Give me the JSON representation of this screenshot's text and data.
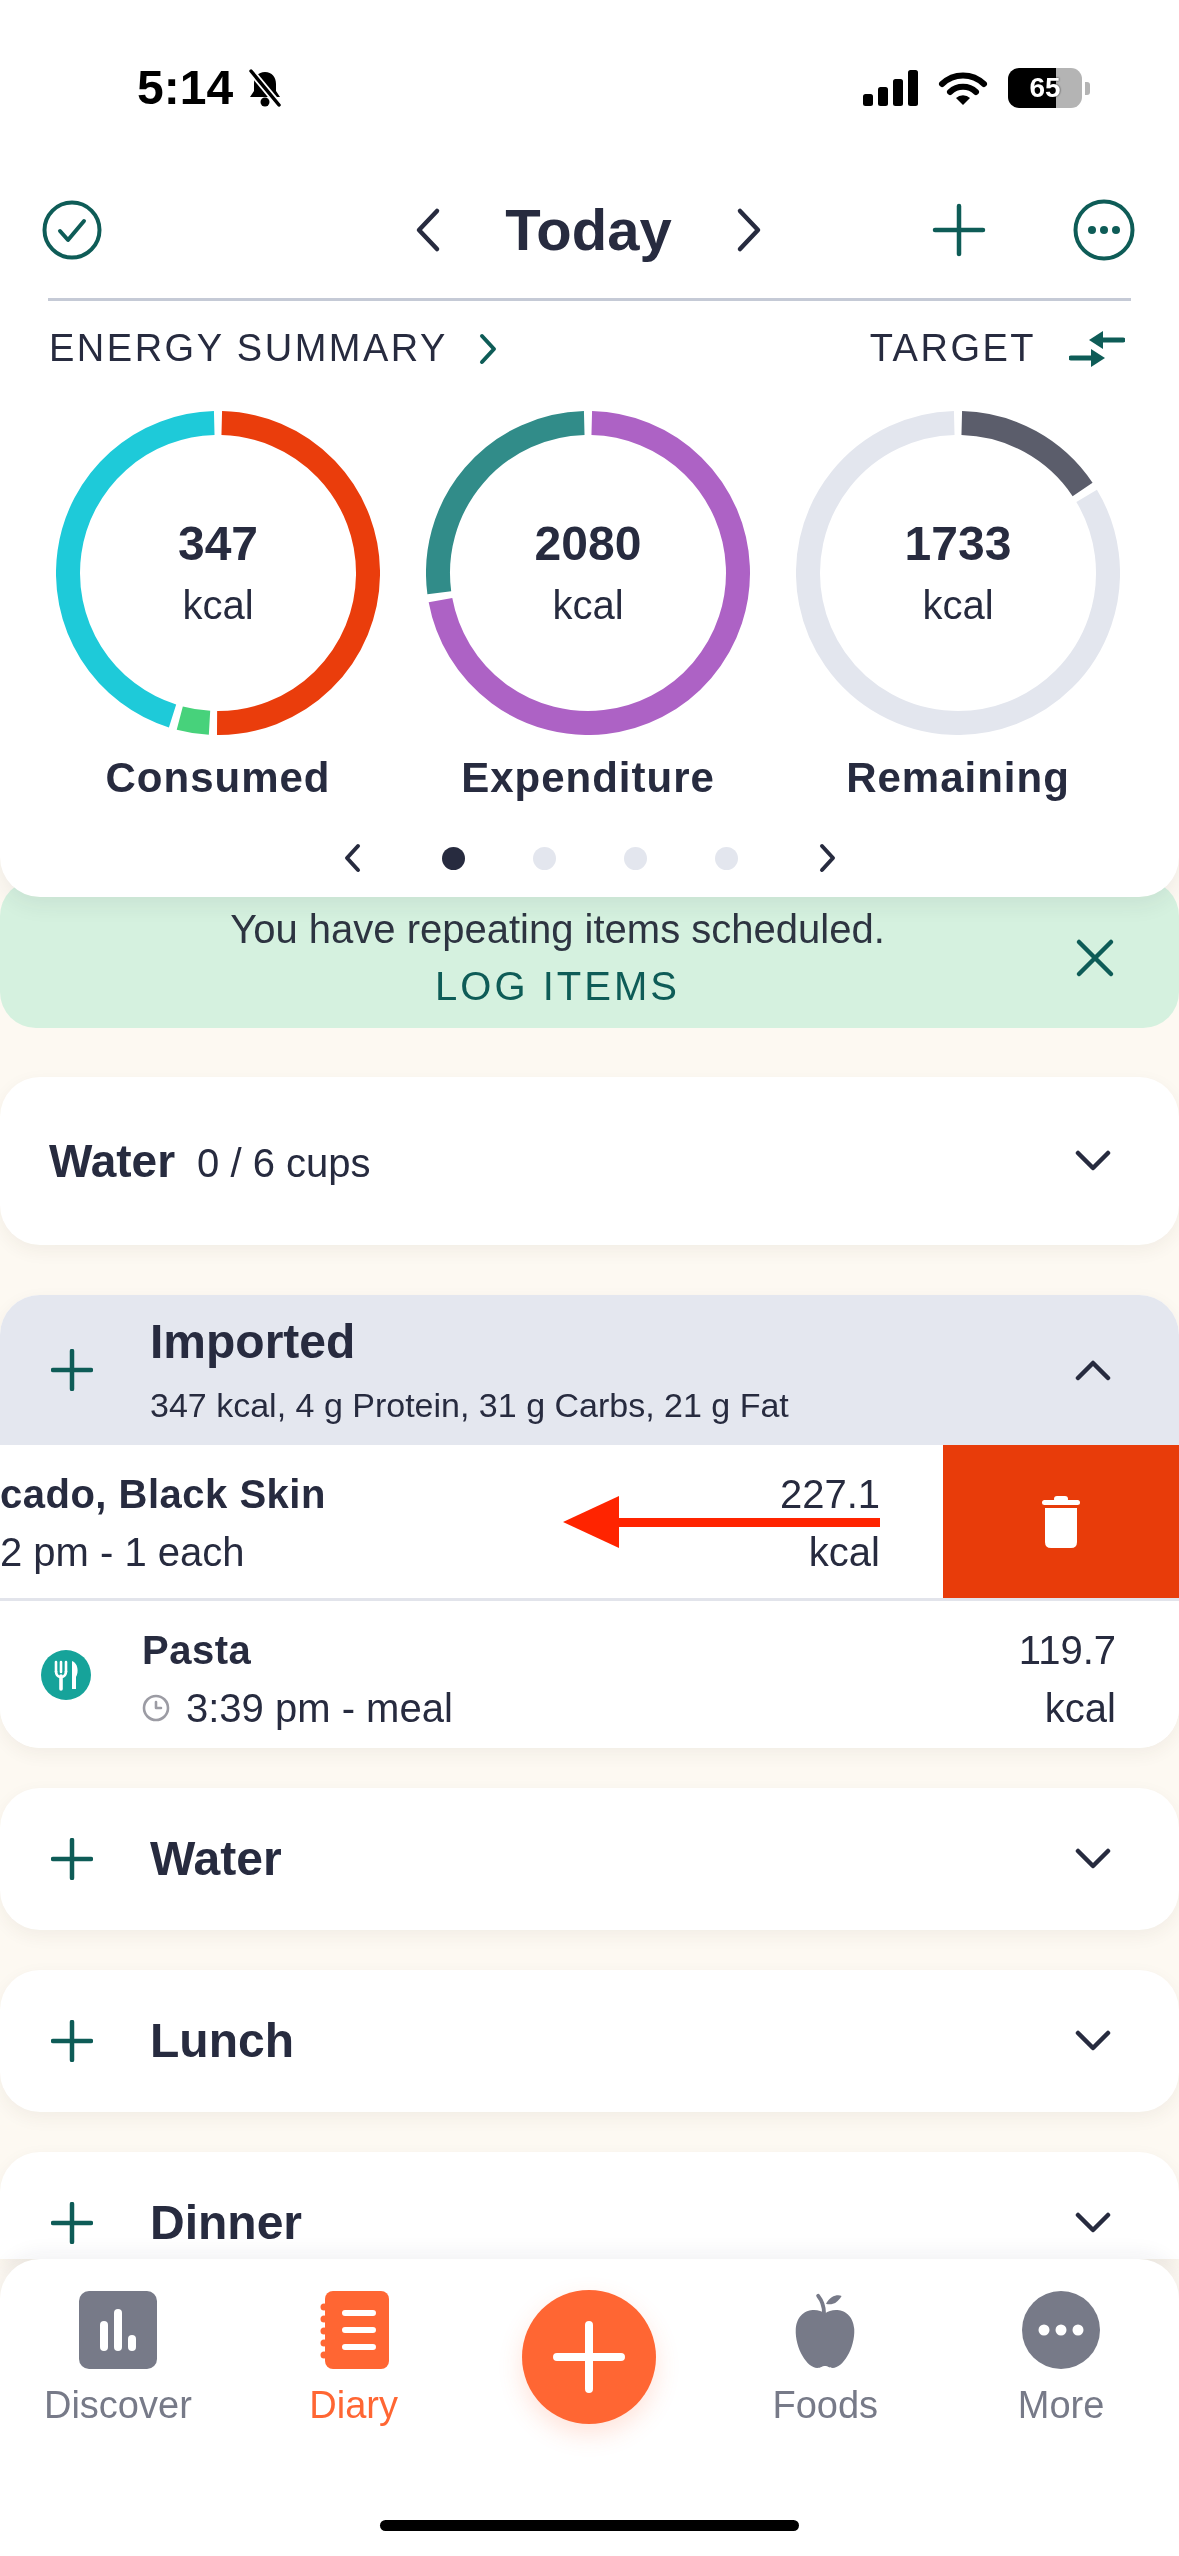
{
  "status_bar": {
    "time": "5:14",
    "battery": "65"
  },
  "header": {
    "title": "Today"
  },
  "energy_summary": {
    "title": "ENERGY SUMMARY",
    "target_label": "TARGET",
    "rings": [
      {
        "value": "347",
        "unit": "kcal",
        "label": "Consumed"
      },
      {
        "value": "2080",
        "unit": "kcal",
        "label": "Expenditure"
      },
      {
        "value": "1733",
        "unit": "kcal",
        "label": "Remaining"
      }
    ],
    "pager": [
      {
        "selected": true
      },
      {
        "selected": false
      },
      {
        "selected": false
      },
      {
        "selected": false
      }
    ]
  },
  "banner": {
    "message": "You have repeating items scheduled.",
    "action": "LOG ITEMS"
  },
  "water_tracker": {
    "title": "Water",
    "amount": "0 / 6 cups",
    "expanded": false
  },
  "meals": [
    {
      "title": "Imported",
      "summary": "347 kcal, 4 g Protein, 31 g Carbs, 21 g Fat",
      "expanded": true,
      "items": [
        {
          "name": "cado, Black Skin",
          "detail": "2 pm - 1 each",
          "calories": "227.1",
          "unit": "kcal",
          "swiped": true
        },
        {
          "name": "Pasta",
          "detail": "3:39 pm - meal",
          "calories": "119.7",
          "unit": "kcal",
          "swiped": false
        }
      ]
    },
    {
      "title": "Water",
      "expanded": false
    },
    {
      "title": "Lunch",
      "expanded": false
    },
    {
      "title": "Dinner",
      "expanded": false
    }
  ],
  "tab_bar": {
    "tabs": [
      {
        "label": "Discover",
        "selected": false
      },
      {
        "label": "Diary",
        "selected": true
      },
      {
        "label": "Foods",
        "selected": false
      },
      {
        "label": "More",
        "selected": false
      }
    ]
  }
}
